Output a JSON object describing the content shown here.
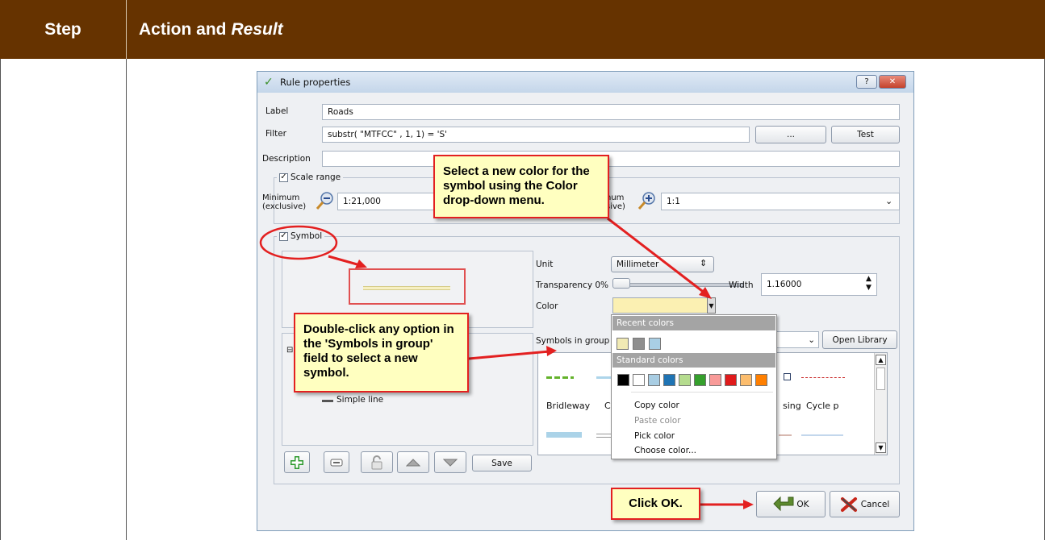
{
  "table": {
    "col_step": "Step",
    "col_action": "Action and",
    "col_action_italic": "Result",
    "header_color": "#663300"
  },
  "dialog": {
    "title": "Rule properties",
    "help_btn": "?",
    "close_btn": "✕",
    "label_label": "Label",
    "label_value": "Roads",
    "filter_label": "Filter",
    "filter_value": "substr( \"MTFCC\" , 1, 1) = 'S'",
    "filter_dots": "...",
    "filter_test": "Test",
    "description_label": "Description",
    "description_value": "",
    "scale_range_label": "Scale range",
    "minimum_label_1": "Minimum",
    "minimum_label_2": "(exclusive)",
    "minimum_value": "1:21,000",
    "maximum_label_1": "num",
    "maximum_label_2": "sive)",
    "maximum_value": "1:1",
    "symbol_label": "Symbol",
    "unit_label": "Unit",
    "unit_value": "Millimeter",
    "transparency_label": "Transparency 0%",
    "width_label": "Width",
    "width_value": "1.16000",
    "color_label": "Color",
    "color_value": "#fbf0b2",
    "symbols_in_group_label": "Symbols in group",
    "open_library": "Open Library",
    "tree_item": "Simple line",
    "symbol_names": [
      "Bridleway",
      "C",
      "sing",
      "Cycle p"
    ],
    "save_button": "Save",
    "ok_button": "OK",
    "cancel_button": "Cancel"
  },
  "color_menu": {
    "recent_header": "Recent colors",
    "recent_colors": [
      "#f1eab4",
      "#8e8e8e",
      "#a9cfe5"
    ],
    "standard_header": "Standard colors",
    "standard_colors": [
      "#000000",
      "#ffffff",
      "#a8cde3",
      "#1f74b4",
      "#b5dc8e",
      "#35a02c",
      "#f89a98",
      "#e01b1c",
      "#fcbd6d",
      "#ff7f00"
    ],
    "items": [
      "Copy color",
      "Paste color",
      "Pick color",
      "Choose color..."
    ]
  },
  "callouts": {
    "color_tip": "Select a new color for the symbol using the Color drop-down menu.",
    "symbols_tip": "Double-click any option in the 'Symbols in group' field to select a new symbol.",
    "ok_tip": "Click OK."
  },
  "annotation_color": "#e32020"
}
